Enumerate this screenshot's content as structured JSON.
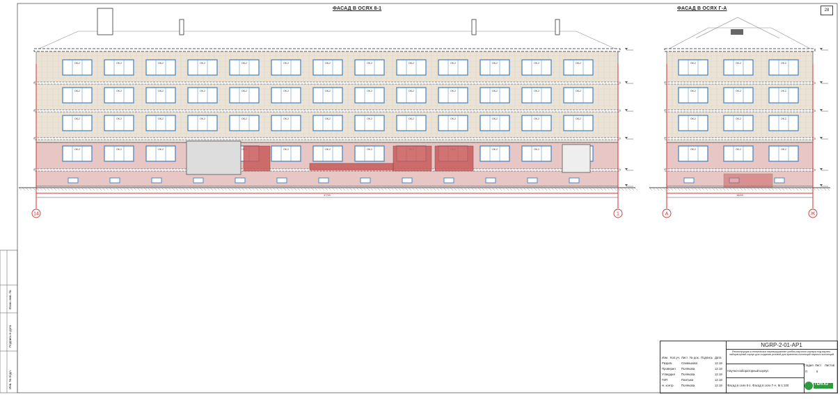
{
  "sheet": {
    "number": "28",
    "frame_color": "#333333"
  },
  "facade_main": {
    "title": "ФАСАД В ОСЯХ 8-1",
    "axis_left": "14",
    "axis_right": "1",
    "window_tag": "ОК-2",
    "window_tag_alt": "ОК-1",
    "basement_tag": "ОК-4",
    "overall_dim": "47700"
  },
  "facade_side": {
    "title": "ФАСАД В ОСЯХ Г-А",
    "axis_left": "А",
    "axis_right": "Ж",
    "window_tag": "ОК-2",
    "overall_dim": "15200"
  },
  "colors": {
    "wall_upper": "#ebe3d6",
    "wall_lower": "#e9c6c6",
    "brick_red": "#c95b5b",
    "window_blue": "#3f7fc0",
    "axis_red": "#d23030",
    "line": "#444444"
  },
  "title_block": {
    "code": "NGRP-2-01-AP1",
    "project": "Реконструкция и техническое перевооружение учебно-научного корпуса под научно-лабораторный корпус для создания условий для хранения коллекций научных коллекций",
    "building": "Научно-лабораторный корпус",
    "sheet_desc": "Фасад в осях 8-1. Фасад в осях Г-А. М 1:100",
    "stage_label": "Стадия",
    "sheet_label": "Лист",
    "sheets_label": "Листов",
    "stage": "П",
    "sheet": "9",
    "roles": [
      "Разраб.",
      "Проверил",
      "Утвердил",
      "ГИП",
      "Н. контр."
    ],
    "names": [
      "Спивашова",
      "Полякова",
      "Полякова",
      "Пантыка",
      "Полякова"
    ],
    "dates": [
      "12.18",
      "12.18",
      "12.18",
      "12.18",
      "12.18"
    ],
    "header_cols": [
      "Изм.",
      "Кол.уч.",
      "Лист",
      "№ док.",
      "Подпись",
      "Дата"
    ],
    "logo": "ГЕНГАЗ"
  },
  "left_stamp": [
    "Инв. № подл.",
    "Подпись и дата",
    "Взам. инв. №"
  ]
}
